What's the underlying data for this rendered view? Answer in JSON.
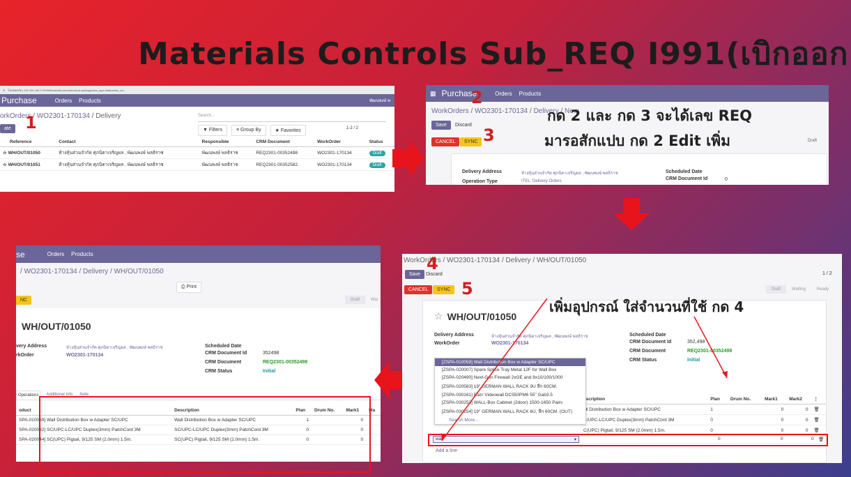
{
  "title": "Materials Controls Sub_REQ I991(เบิกออก)",
  "steps": {
    "n1": "1",
    "n2": "2",
    "n3": "3",
    "n4": "4",
    "n5": "5"
  },
  "annotation_top": {
    "line1": "กด 2 และ กด 3 จะได้เลข REQ",
    "line2": "มารอสักแปบ กด 2 Edit เพิ่ม"
  },
  "annotation_bottom": "เพิ่มอุปกรณ์ ใส่จำนวนที่ใช้ กด 4",
  "shot1": {
    "url": "ไม่ปลอดภัย | 202.151.183.173:8069/web#id=&model=stock.picking&view_type=list&action_id=...",
    "app": "Purchase",
    "menu_orders": "Orders",
    "menu_products": "Products",
    "user": "พัฒนพงษ์ พ",
    "bc_1": "orkOrders",
    "bc_sep1": " / ",
    "bc_2": "WO2301-170134",
    "bc_sep2": " / ",
    "bc_3": "Delivery",
    "create": "ate",
    "search_placeholder": "Search...",
    "filters": "Filters",
    "group_by": "Group By",
    "favorites": "Favorites",
    "pager": "1-2 / 2",
    "columns": [
      "Reference",
      "Contact",
      "Responsible",
      "CRM Document",
      "WorkOrder",
      "Status"
    ],
    "rows": [
      {
        "ref": "WH/OUT/01050",
        "contact": "ห้างหุ้นส่วนจำกัด ศุภนิตาเจริญผล , พัฒนพงษ์ พลธิราช",
        "resp": "พัฒนพงษ์ พลธิราช",
        "crm": "REQ2301-00352498",
        "wo": "WO2301-170134",
        "status": "Draft"
      },
      {
        "ref": "WH/OUT/01051",
        "contact": "ห้างหุ้นส่วนจำกัด ศุภนิตาเจริญผล , พัฒนพงษ์ พลธิราช",
        "resp": "พัฒนพงษ์ พลธิราช",
        "crm": "REQ2301-00352582",
        "wo": "WO2301-170134",
        "status": "Draft"
      }
    ]
  },
  "shot2": {
    "app": "Purchase",
    "menu_orders": "Orders",
    "menu_products": "Products",
    "bc_1": "WorkOrders",
    "bc_2": "WO2301-170134",
    "bc_3": "Delivery / New",
    "save": "Save",
    "discard": "Discard",
    "cancel": "CANCEL",
    "sync": "SYNC",
    "draft": "Draft",
    "delivery_address_label": "Delivery Address",
    "delivery_address_value": "ห้างหุ้นส่วนจำกัด ศุภนิตาเจริญผล , พัฒนพงษ์ พลธิราช",
    "operation_type_label": "Operation Type",
    "operation_type_value": "ITEL: Delivery Orders",
    "scheduled_label": "Scheduled Date",
    "crm_id_label": "CRM Document Id",
    "crm_id_value": "0"
  },
  "shot3": {
    "app": "se",
    "menu_orders": "Orders",
    "menu_products": "Products",
    "bc": "WO2301-170134 / Delivery / WH/OUT/01050",
    "print": "Print",
    "sync": "NC",
    "draft": "Draft",
    "waiting": "Wai",
    "record_title": "WH/OUT/01050",
    "delivery_address_label": "very Address",
    "delivery_address_value": "ห้างหุ้นส่วนจำกัด ศุภนิตาเจริญผล , พัฒนพงษ์ พลธิราช",
    "workorder_label": "rkOrder",
    "workorder_value": "WO2301-170134",
    "scheduled_label": "Scheduled Date",
    "crm_id_label": "CRM Document Id",
    "crm_id_value": "352498",
    "crm_doc_label": "CRM Document",
    "crm_doc_value": "REQ2301-00352498",
    "crm_status_label": "CRM Status",
    "crm_status_value": "Initial",
    "tab_ops": "Operations",
    "tab_add": "Additional Info",
    "tab_note": "Note",
    "columns": [
      "oduct",
      "Description",
      "Plan",
      "Drum No.",
      "Mark1",
      "Ma"
    ],
    "rows": [
      {
        "p": "SPA-010059] Wall Distribution Box w Adapter SC/UPC",
        "d": "Wall Distribution Box w Adapter SC/UPC",
        "plan": "1",
        "m1": "0"
      },
      {
        "p": "SPA-020092] SC/UPC-LC/UPC Duplex(3mm) PatchCord 3M",
        "d": "SC/UPC-LC/UPC Duplex(3mm) PatchCord 3M",
        "plan": "0",
        "m1": "0"
      },
      {
        "p": "SPA-020044] SC(UPC) Pigtail, 9/125 SM (2.0mm) 1.5m.",
        "d": "SC(UPC) Pigtail, 9/125 SM (2.0mm) 1.5m.",
        "plan": "0",
        "m1": "0"
      }
    ]
  },
  "shot4": {
    "bc": "WorkOrders / WO2301-170134 / Delivery / WH/OUT/01050",
    "save": "Save",
    "discard": "Discard",
    "pager": "1 / 2",
    "cancel": "CANCEL",
    "sync": "SYNC",
    "draft": "Draft",
    "waiting": "Waiting",
    "ready": "Ready",
    "record_title": "WH/OUT/01050",
    "delivery_address_label": "Delivery Address",
    "delivery_address_value": "ห้างหุ้นส่วนจำกัด ศุภนิตาเจริญผล , พัฒนพงษ์ พลธิราช",
    "workorder_label": "WorkOrder",
    "workorder_value": "WO2301-170134",
    "scheduled_label": "Scheduled Date",
    "crm_id_label": "CRM Document Id",
    "crm_id_value": "352,498",
    "crm_doc_label": "CRM Document",
    "crm_doc_value": "REQ2301-00352498",
    "crm_status_label": "CRM Status",
    "crm_status_value": "Initial",
    "dropdown": [
      "[ZSPA-010059] Wall Distribution Box w Adapter SC/UPC",
      "[ZSPA-020007] Spare Splice Tray Metal 12F for Wall Box",
      "[ZSPA-020490] Next-Gen Firewall 2xGE and 8x10/100/1000",
      "[ZSPA-020583] 19\" GERMAN WALL RACK 9U ลึก 60CM.",
      "[ZSPA-030161] Razr Videowall DC550PM6 55\" Gab3.5",
      "[ZSPA-030253] WALL-Box Cabinet (2door) 1500-1650 Pairs",
      "[ZSPA-030254] 19\" GERMAN WALL RACK 6U, ลึก 60CM. (OUT)"
    ],
    "search_more": "Search More...",
    "columns": [
      "escription",
      "Plan",
      "Drum No.",
      "Mark1",
      "Mark2"
    ],
    "rows": [
      {
        "d": "all Distribution Box w Adapter SC/UPC",
        "plan": "1",
        "m1": "0",
        "m2": "0"
      },
      {
        "d": "C/UPC-LC/UPC Duplex(3mm) PatchCord 3M",
        "plan": "0",
        "m1": "0",
        "m2": "0"
      },
      {
        "d": "C(UPC) Pigtail, 9/125 SM (2.0mm) 1.5m.",
        "plan": "0",
        "m1": "0",
        "m2": "0"
      }
    ],
    "input_value": "wall",
    "edit_row": {
      "plan": "0",
      "m1": "0",
      "m2": "0"
    },
    "add_line": "Add a line"
  },
  "colors": {
    "odoo_purple": "#6b6699",
    "arrow_red": "#e8141c",
    "cancel_red": "#e0322f",
    "sync_yellow": "#f5c518"
  }
}
